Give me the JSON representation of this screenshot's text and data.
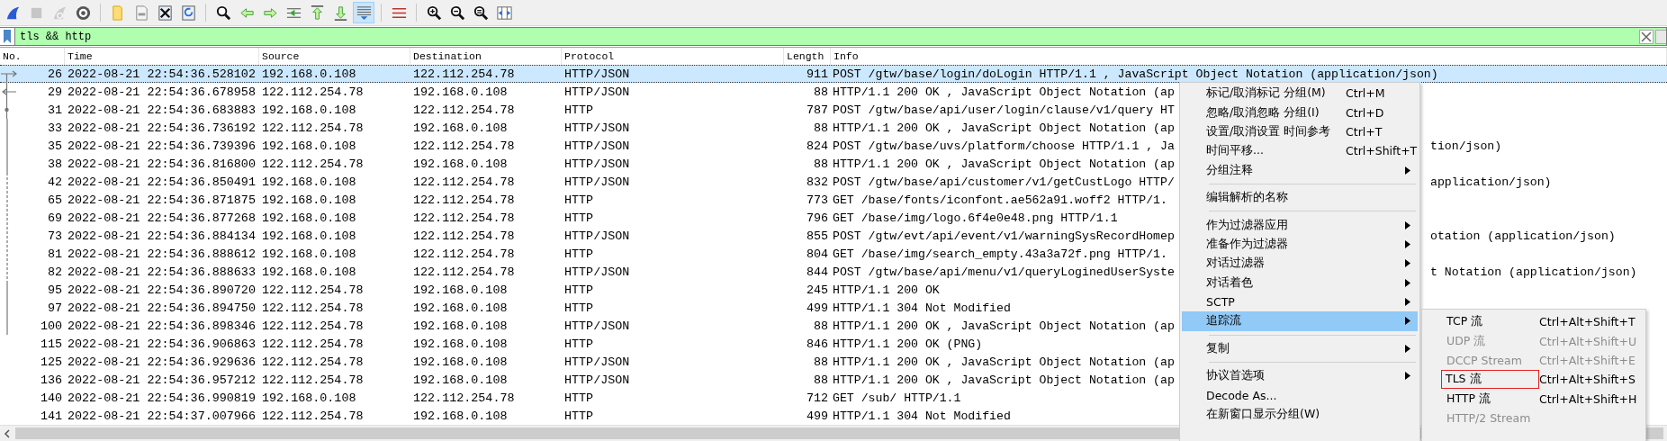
{
  "toolbar": {
    "buttons": [
      {
        "pressed": false,
        "disabled": false
      },
      {
        "pressed": false,
        "disabled": true
      },
      {
        "pressed": false,
        "disabled": true
      },
      {
        "pressed": false,
        "disabled": false
      },
      {
        "pressed": false,
        "disabled": false
      },
      {
        "pressed": false,
        "disabled": false
      },
      {
        "pressed": false,
        "disabled": false
      },
      {
        "pressed": false,
        "disabled": false
      },
      {
        "pressed": false,
        "disabled": false
      },
      {
        "pressed": false,
        "disabled": false
      },
      {
        "pressed": false,
        "disabled": false
      },
      {
        "pressed": false,
        "disabled": false
      },
      {
        "pressed": false,
        "disabled": false
      },
      {
        "pressed": false,
        "disabled": false
      },
      {
        "pressed": true,
        "disabled": false
      },
      {
        "pressed": false,
        "disabled": false
      },
      {
        "pressed": false,
        "disabled": false
      },
      {
        "pressed": false,
        "disabled": false
      },
      {
        "pressed": false,
        "disabled": false
      },
      {
        "pressed": false,
        "disabled": false
      }
    ]
  },
  "filter_bar": {
    "value": "tls && http"
  },
  "packet_list": {
    "columns": [
      "No.",
      "Time",
      "Source",
      "Destination",
      "Protocol",
      "Length",
      "Info"
    ],
    "rows": [
      {
        "no": "26",
        "time": "2022-08-21 22:54:36.528102",
        "source": "192.168.0.108",
        "destination": "122.112.254.78",
        "protocol": "HTTP/JSON",
        "length": "911",
        "info": "POST /gtw/base/login/doLogin HTTP/1.1 , JavaScript Object Notation (application/json)",
        "selected": true,
        "kind": "request"
      },
      {
        "no": "29",
        "time": "2022-08-21 22:54:36.678958",
        "source": "122.112.254.78",
        "destination": "192.168.0.108",
        "protocol": "HTTP/JSON",
        "length": "88",
        "info": "HTTP/1.1 200 OK , JavaScript Object Notation (ap",
        "selected": false,
        "kind": "response"
      },
      {
        "no": "31",
        "time": "2022-08-21 22:54:36.683883",
        "source": "192.168.0.108",
        "destination": "122.112.254.78",
        "protocol": "HTTP",
        "length": "787",
        "info": "POST /gtw/base/api/user/login/clause/v1/query HT",
        "selected": false,
        "kind": "related"
      },
      {
        "no": "33",
        "time": "2022-08-21 22:54:36.736192",
        "source": "122.112.254.78",
        "destination": "192.168.0.108",
        "protocol": "HTTP/JSON",
        "length": "88",
        "info": "HTTP/1.1 200 OK , JavaScript Object Notation (ap",
        "selected": false,
        "kind": "line"
      },
      {
        "no": "35",
        "time": "2022-08-21 22:54:36.739396",
        "source": "192.168.0.108",
        "destination": "122.112.254.78",
        "protocol": "HTTP/JSON",
        "length": "824",
        "info": "POST /gtw/base/uvs/platform/choose HTTP/1.1 , Ja",
        "info_tail": "tion/json)",
        "selected": false,
        "kind": "line"
      },
      {
        "no": "38",
        "time": "2022-08-21 22:54:36.816800",
        "source": "122.112.254.78",
        "destination": "192.168.0.108",
        "protocol": "HTTP/JSON",
        "length": "88",
        "info": "HTTP/1.1 200 OK , JavaScript Object Notation (ap",
        "selected": false,
        "kind": "line"
      },
      {
        "no": "42",
        "time": "2022-08-21 22:54:36.850491",
        "source": "192.168.0.108",
        "destination": "122.112.254.78",
        "protocol": "HTTP/JSON",
        "length": "832",
        "info": "POST /gtw/base/api/customer/v1/getCustLogo HTTP/",
        "info_tail": "application/json)",
        "selected": false,
        "kind": "dashed"
      },
      {
        "no": "65",
        "time": "2022-08-21 22:54:36.871875",
        "source": "192.168.0.108",
        "destination": "122.112.254.78",
        "protocol": "HTTP",
        "length": "773",
        "info": "GET /base/fonts/iconfont.ae562a91.woff2 HTTP/1.",
        "selected": false,
        "kind": "dashed"
      },
      {
        "no": "69",
        "time": "2022-08-21 22:54:36.877268",
        "source": "192.168.0.108",
        "destination": "122.112.254.78",
        "protocol": "HTTP",
        "length": "796",
        "info": "GET /base/img/logo.6f4e0e48.png HTTP/1.1",
        "selected": false,
        "kind": "dashed"
      },
      {
        "no": "73",
        "time": "2022-08-21 22:54:36.884134",
        "source": "192.168.0.108",
        "destination": "122.112.254.78",
        "protocol": "HTTP/JSON",
        "length": "855",
        "info": "POST /gtw/evt/api/event/v1/warningSysRecordHomep",
        "info_tail": "otation (application/json)",
        "selected": false,
        "kind": "dashed"
      },
      {
        "no": "81",
        "time": "2022-08-21 22:54:36.888612",
        "source": "192.168.0.108",
        "destination": "122.112.254.78",
        "protocol": "HTTP",
        "length": "804",
        "info": "GET /base/img/search_empty.43a3a72f.png HTTP/1.",
        "selected": false,
        "kind": "dashed"
      },
      {
        "no": "82",
        "time": "2022-08-21 22:54:36.888633",
        "source": "192.168.0.108",
        "destination": "122.112.254.78",
        "protocol": "HTTP/JSON",
        "length": "844",
        "info": "POST /gtw/base/api/menu/v1/queryLoginedUserSyste",
        "info_tail": "t Notation (application/json)",
        "selected": false,
        "kind": "dashed"
      },
      {
        "no": "95",
        "time": "2022-08-21 22:54:36.890720",
        "source": "122.112.254.78",
        "destination": "192.168.0.108",
        "protocol": "HTTP",
        "length": "245",
        "info": "HTTP/1.1 200 OK",
        "selected": false,
        "kind": "line"
      },
      {
        "no": "97",
        "time": "2022-08-21 22:54:36.894750",
        "source": "122.112.254.78",
        "destination": "192.168.0.108",
        "protocol": "HTTP",
        "length": "499",
        "info": "HTTP/1.1 304 Not Modified",
        "selected": false,
        "kind": "line"
      },
      {
        "no": "100",
        "time": "2022-08-21 22:54:36.898346",
        "source": "122.112.254.78",
        "destination": "192.168.0.108",
        "protocol": "HTTP/JSON",
        "length": "88",
        "info": "HTTP/1.1 200 OK , JavaScript Object Notation (ap",
        "selected": false,
        "kind": "line"
      },
      {
        "no": "115",
        "time": "2022-08-21 22:54:36.906863",
        "source": "122.112.254.78",
        "destination": "192.168.0.108",
        "protocol": "HTTP",
        "length": "846",
        "info": "HTTP/1.1 200 OK  (PNG)",
        "selected": false
      },
      {
        "no": "125",
        "time": "2022-08-21 22:54:36.929636",
        "source": "122.112.254.78",
        "destination": "192.168.0.108",
        "protocol": "HTTP/JSON",
        "length": "88",
        "info": "HTTP/1.1 200 OK , JavaScript Object Notation (ap",
        "selected": false
      },
      {
        "no": "136",
        "time": "2022-08-21 22:54:36.957212",
        "source": "122.112.254.78",
        "destination": "192.168.0.108",
        "protocol": "HTTP/JSON",
        "length": "88",
        "info": "HTTP/1.1 200 OK , JavaScript Object Notation (ap",
        "selected": false
      },
      {
        "no": "140",
        "time": "2022-08-21 22:54:36.990819",
        "source": "192.168.0.108",
        "destination": "122.112.254.78",
        "protocol": "HTTP",
        "length": "712",
        "info": "GET /sub/ HTTP/1.1",
        "selected": false
      },
      {
        "no": "141",
        "time": "2022-08-21 22:54:37.007966",
        "source": "122.112.254.78",
        "destination": "192.168.0.108",
        "protocol": "HTTP",
        "length": "499",
        "info": "HTTP/1.1 304 Not Modified",
        "selected": false
      }
    ]
  },
  "context_menu": {
    "items": [
      {
        "kind": "item",
        "label": "标记/取消标记 分组(M)",
        "shortcut": "Ctrl+M",
        "submenu": false,
        "selected": false
      },
      {
        "kind": "item",
        "label": "忽略/取消忽略 分组(I)",
        "shortcut": "Ctrl+D",
        "submenu": false,
        "selected": false
      },
      {
        "kind": "item",
        "label": "设置/取消设置 时间参考",
        "shortcut": "Ctrl+T",
        "submenu": false,
        "selected": false
      },
      {
        "kind": "item",
        "label": "时间平移...",
        "shortcut": "Ctrl+Shift+T",
        "submenu": false,
        "selected": false
      },
      {
        "kind": "item",
        "label": "分组注释",
        "submenu": true,
        "selected": false
      },
      {
        "kind": "separator"
      },
      {
        "kind": "item",
        "label": "编辑解析的名称",
        "submenu": false,
        "selected": false
      },
      {
        "kind": "separator"
      },
      {
        "kind": "item",
        "label": "作为过滤器应用",
        "submenu": true,
        "selected": false
      },
      {
        "kind": "item",
        "label": "准备作为过滤器",
        "submenu": true,
        "selected": false
      },
      {
        "kind": "item",
        "label": "对话过滤器",
        "submenu": true,
        "selected": false
      },
      {
        "kind": "item",
        "label": "对话着色",
        "submenu": true,
        "selected": false
      },
      {
        "kind": "item",
        "label": "SCTP",
        "submenu": true,
        "selected": false
      },
      {
        "kind": "item",
        "label": "追踪流",
        "submenu": true,
        "selected": true
      },
      {
        "kind": "separator"
      },
      {
        "kind": "item",
        "label": "复制",
        "submenu": true,
        "selected": false
      },
      {
        "kind": "separator"
      },
      {
        "kind": "item",
        "label": "协议首选项",
        "submenu": true,
        "selected": false
      },
      {
        "kind": "item",
        "label": "Decode As...",
        "submenu": false,
        "selected": false
      },
      {
        "kind": "item",
        "label": "在新窗口显示分组(W)",
        "submenu": false,
        "selected": false
      }
    ]
  },
  "submenu": {
    "items": [
      {
        "label": "TCP 流",
        "shortcut": "Ctrl+Alt+Shift+T",
        "disabled": false,
        "outlined": false
      },
      {
        "label": "UDP 流",
        "shortcut": "Ctrl+Alt+Shift+U",
        "disabled": true,
        "outlined": false
      },
      {
        "label": "DCCP Stream",
        "shortcut": "Ctrl+Alt+Shift+E",
        "disabled": true,
        "outlined": false
      },
      {
        "label": "TLS 流",
        "shortcut": "Ctrl+Alt+Shift+S",
        "disabled": false,
        "outlined": true
      },
      {
        "label": "HTTP 流",
        "shortcut": "Ctrl+Alt+Shift+H",
        "disabled": false,
        "outlined": false
      },
      {
        "label": "HTTP/2 Stream",
        "disabled": true,
        "outlined": false
      }
    ]
  }
}
